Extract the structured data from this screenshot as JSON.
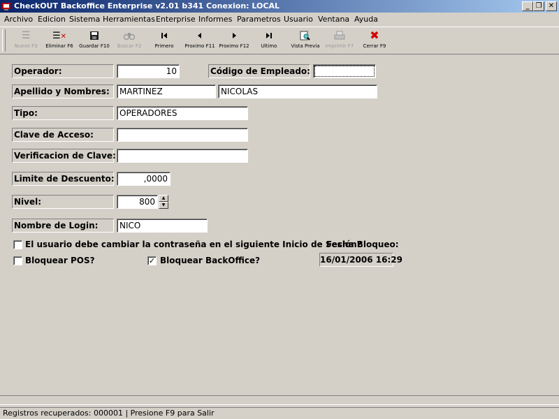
{
  "window": {
    "title": "CheckOUT Backoffice Enterprise v2.01 b341 Conexion: LOCAL",
    "buttons": [
      "_",
      "❐",
      "✕"
    ]
  },
  "menu": [
    "Archivo",
    "Edicion",
    "Sistema",
    "Herramientas",
    "Enterprise",
    "Informes",
    "Parametros",
    "Usuario",
    "Ventana",
    "Ayuda"
  ],
  "toolbar": [
    {
      "label": "Nuevo F3",
      "icon": "new-icon",
      "glyph": "☰",
      "enabled": false
    },
    {
      "label": "Eliminar F6",
      "icon": "delete-icon",
      "glyph": "☰",
      "enabled": true
    },
    {
      "label": "Guardar F10",
      "icon": "save-icon",
      "glyph": "💾",
      "enabled": true
    },
    {
      "label": "Buscar F2",
      "icon": "search-icon",
      "glyph": "🔍",
      "enabled": false
    },
    {
      "label": "Primero",
      "icon": "first-icon",
      "glyph": "⏮",
      "enabled": true
    },
    {
      "label": "Proximo F11",
      "icon": "previous-icon",
      "glyph": "◀",
      "enabled": true
    },
    {
      "label": "Proximo F12",
      "icon": "next-icon",
      "glyph": "▶",
      "enabled": true
    },
    {
      "label": "Ultimo",
      "icon": "last-icon",
      "glyph": "⏭",
      "enabled": true
    },
    {
      "label": "Vista Previa",
      "icon": "preview-icon",
      "glyph": "🔎",
      "enabled": true
    },
    {
      "label": "Imprimir F7",
      "icon": "print-icon",
      "glyph": "🖶",
      "enabled": false
    },
    {
      "label": "Cerrar F9",
      "icon": "close-icon",
      "glyph": "✖",
      "enabled": true
    }
  ],
  "form": {
    "operador_label": "Operador:",
    "operador_value": "10",
    "codigo_label": "Código de Empleado:",
    "codigo_value": "",
    "apellido_label": "Apellido y Nombres:",
    "apellido_value": "MARTINEZ",
    "nombres_value": "NICOLAS",
    "tipo_label": "Tipo:",
    "tipo_value": "OPERADORES",
    "clave_label": "Clave de Acceso:",
    "clave_value": "",
    "verif_label": "Verificacion de Clave:",
    "verif_value": "",
    "limite_label": "Limite de Descuento:",
    "limite_value": ",0000",
    "nivel_label": "Nivel:",
    "nivel_value": "800",
    "login_label": "Nombre de Login:",
    "login_value": "NICO",
    "cambiar_label": "El usuario debe cambiar la contraseña en el siguiente Inicio de Sesión?",
    "cambiar_checked": false,
    "pos_label": "Bloquear POS?",
    "pos_checked": false,
    "backoffice_label": "Bloquear BackOffice?",
    "backoffice_checked": true,
    "fecha_label": "Fecha Bloqueo:",
    "fecha_value": "16/01/2006 16:29"
  },
  "status": "Registros recuperados: 000001 | Presione F9 para Salir"
}
